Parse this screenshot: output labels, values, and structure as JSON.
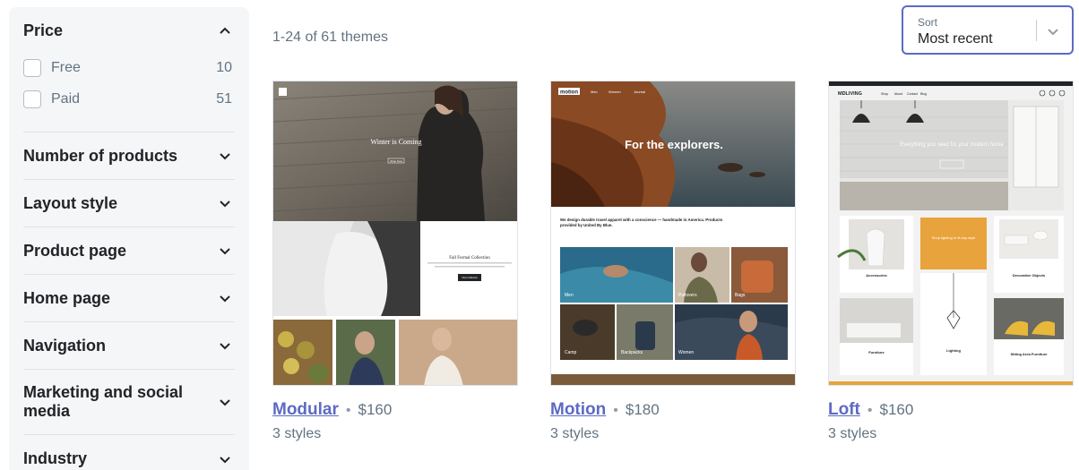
{
  "filters": {
    "price": {
      "title": "Price",
      "options": [
        {
          "label": "Free",
          "count": "10"
        },
        {
          "label": "Paid",
          "count": "51"
        }
      ]
    },
    "sections": [
      "Number of products",
      "Layout style",
      "Product page",
      "Home page",
      "Navigation",
      "Marketing and social media",
      "Industry"
    ]
  },
  "results": {
    "count_text": "1-24 of 61 themes"
  },
  "sort": {
    "label": "Sort",
    "value": "Most recent"
  },
  "themes": [
    {
      "name": "Modular",
      "price": "$160",
      "styles": "3 styles",
      "preview": {
        "hero_title": "Winter is Coming",
        "hero_button": "Shop Now",
        "collection_title": "Fall Formal Collection",
        "collection_button": "View Collection"
      }
    },
    {
      "name": "Motion",
      "price": "$180",
      "styles": "3 styles",
      "preview": {
        "logo": "motion",
        "nav": [
          "Men",
          "Women",
          "Journal"
        ],
        "hero_title": "For the explorers.",
        "tagline": "We design durable travel apparel with a conscience — handmade in America. Products provided by United By Blue.",
        "tiles": [
          "Men",
          "Pullovers",
          "Bags",
          "Camp",
          "Backpacks",
          "Women"
        ]
      }
    },
    {
      "name": "Loft",
      "price": "$160",
      "styles": "3 styles",
      "preview": {
        "logo": "MDLIVING",
        "nav": [
          "Shop",
          "About",
          "Contact",
          "Blog"
        ],
        "hero_title": "Everything you need for your modern home",
        "tiles": [
          "Accessories",
          "Decorative Objects",
          "Furniture",
          "Lighting",
          "Sitting Area Furniture"
        ],
        "promo": "Shop lighting to fit any style"
      }
    }
  ],
  "colors": {
    "accent": "#5c6ac4",
    "muted": "#637381",
    "sidebar_bg": "#f4f6f8"
  }
}
